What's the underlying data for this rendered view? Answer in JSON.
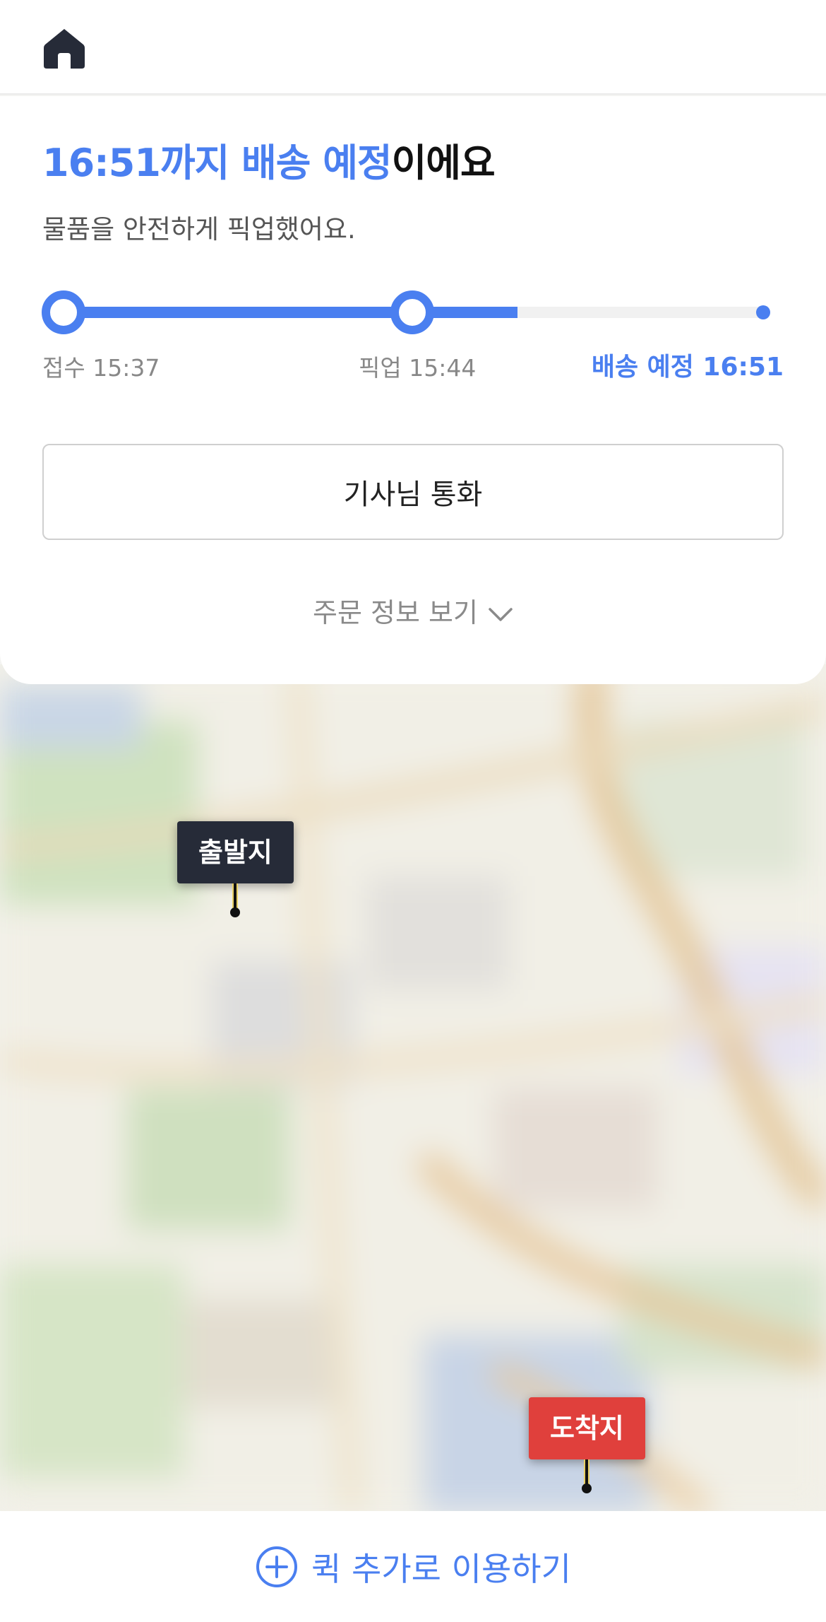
{
  "header": {
    "home_icon": "home-icon"
  },
  "status": {
    "headline_highlight": "16:51까지 배송 예정",
    "headline_rest": "이에요",
    "subtext": "물품을 안전하게 픽업했어요.",
    "progress_fraction": 0.65,
    "steps": [
      {
        "label": "접수 15:37",
        "state": "done"
      },
      {
        "label": "픽업 15:44",
        "state": "done"
      },
      {
        "label": "배송 예정 16:51",
        "state": "pending"
      }
    ],
    "accent_color": "#4a7ff0"
  },
  "actions": {
    "call_driver_label": "기사님 통화",
    "order_info_label": "주문 정보 보기",
    "order_info_icon": "chevron-down-icon"
  },
  "map": {
    "start_label": "출발지",
    "end_label": "도착지",
    "start_color": "#262b38",
    "end_color": "#e0403c"
  },
  "bottom": {
    "quick_add_label": "퀵 추가로 이용하기",
    "quick_add_icon": "plus-circle-icon"
  }
}
